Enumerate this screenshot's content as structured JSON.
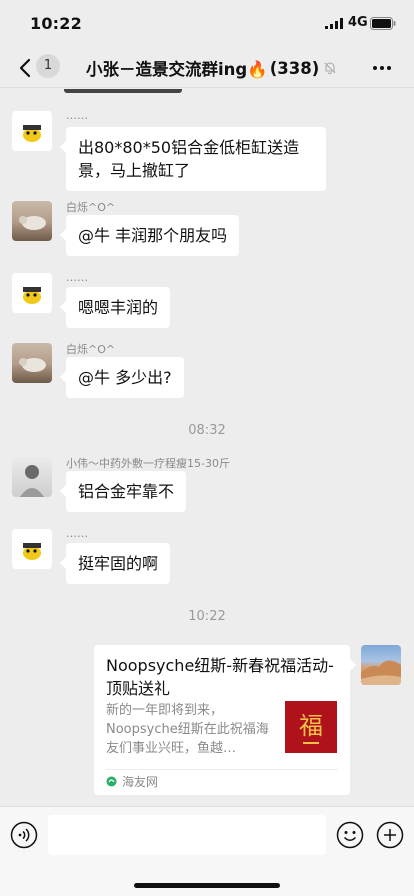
{
  "status_bar": {
    "time": "10:22",
    "network": "4G"
  },
  "nav": {
    "back_badge": "1",
    "title": "小张－造景交流群ing🔥",
    "member_count": "(338)"
  },
  "messages": [
    {
      "nick": "……",
      "text": "出80*80*50铝合金低柜缸送造景，马上撤缸了",
      "avatar": "yellow-cartoon-avatar"
    },
    {
      "nick": "白烁^O^",
      "text": "@牛 丰润那个朋友吗",
      "avatar": "dog-photo-avatar"
    },
    {
      "nick": "……",
      "text": "嗯嗯丰润的",
      "avatar": "yellow-cartoon-avatar"
    },
    {
      "nick": "白烁^O^",
      "text": "@牛 多少出?",
      "avatar": "dog-photo-avatar"
    },
    {
      "nick": "小伟～中药外敷一疗程瘦15-30斤",
      "text": "铝合金牢靠不",
      "avatar": "man-photo-avatar"
    },
    {
      "nick": "……",
      "text": "挺牢固的啊",
      "avatar": "yellow-cartoon-avatar"
    }
  ],
  "timestamps": [
    "08:32",
    "10:22"
  ],
  "share_card": {
    "title": "Noopsyche纽斯-新春祝福活动-顶贴送礼",
    "description": "新的一年即将到来，Noopsyche纽斯在此祝福海友们事业兴旺，鱼越…",
    "thumbnail_char": "福",
    "source": "海友网",
    "avatar": "rock-landscape-avatar"
  },
  "input_bar": {
    "placeholder": ""
  },
  "colors": {
    "background": "#ededed",
    "bubble": "#ffffff",
    "thumb_red": "#b0121b",
    "source_green": "#2aae67"
  }
}
